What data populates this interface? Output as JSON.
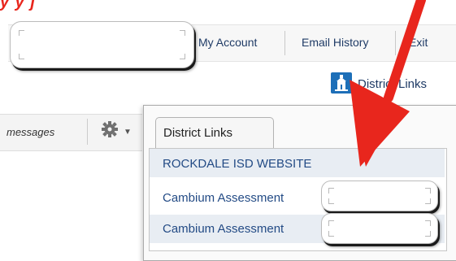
{
  "caption": {
    "text": "y     y     j"
  },
  "topnav": {
    "my_account": "My Account",
    "email_history": "Email History",
    "exit": "Exit"
  },
  "district_links_link": "District Links",
  "toolbar": {
    "messages": "messages"
  },
  "panel": {
    "tab_label": "District Links",
    "items": [
      {
        "label": "ROCKDALE ISD WEBSITE"
      },
      {
        "label": "Cambium Assessment"
      },
      {
        "label": "Cambium Assessment"
      }
    ]
  },
  "colors": {
    "accent_blue": "#1d6fb8",
    "link_text": "#1f3b66",
    "row_highlight": "#e8edf3",
    "annotation_red": "#e8261d"
  },
  "icons": [
    "building-icon",
    "gear-icon",
    "chevron-down-icon",
    "red-arrow-icon"
  ]
}
